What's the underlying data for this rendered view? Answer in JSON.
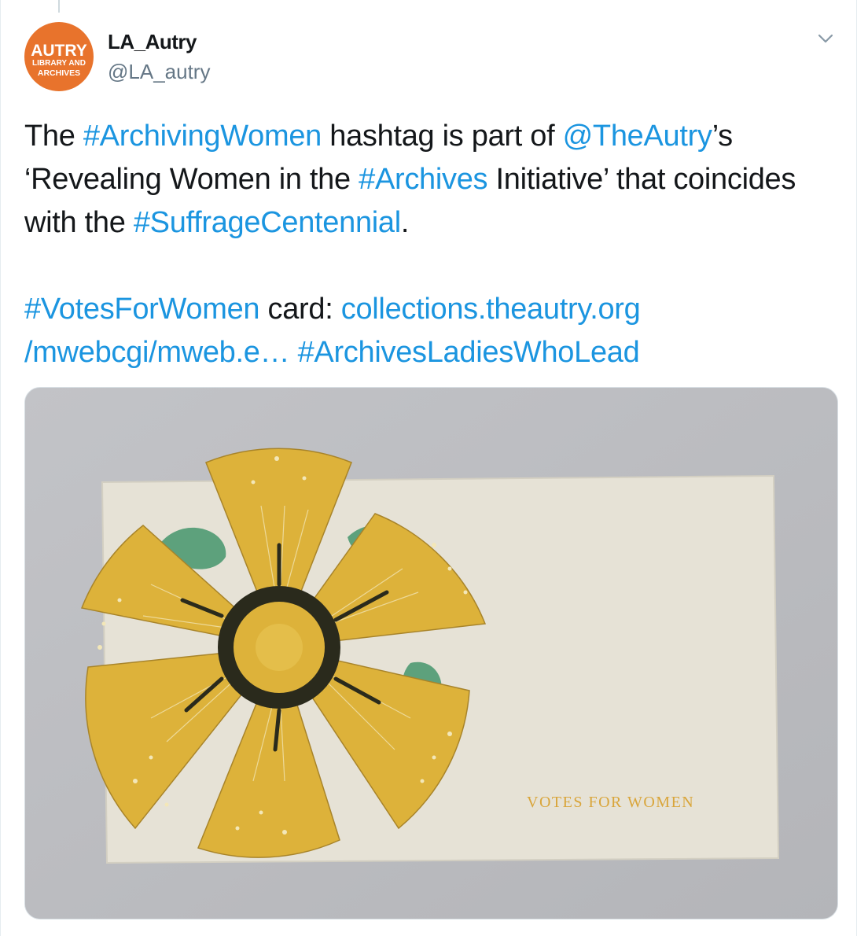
{
  "author": {
    "display_name": "LA_Autry",
    "handle": "@LA_autry",
    "avatar": {
      "line1": "AUTRY",
      "line2": "LIBRARY AND",
      "line3": "ARCHIVES",
      "color": "#e8732c"
    }
  },
  "menu_icon": "chevron-down-icon",
  "tweet": {
    "para1": {
      "t1": "The ",
      "l1": "#ArchivingWomen",
      "t2": " hashtag is part of ",
      "l2": "@TheAutry",
      "t3": "’s ‘Revealing Women in the ",
      "l3": "#Archives",
      "t4": " Initiative’ that coincides with the ",
      "l4": "#SuffrageCentennial",
      "t5": "."
    },
    "para2": {
      "l1": "#VotesForWomen",
      "t1": " card: ",
      "l2": "collections.theautry.org",
      "l3": "/mwebcgi/mweb.e…",
      "l4": "#ArchivesLadiesWhoLead"
    }
  },
  "media": {
    "card_text": "VOTES FOR WOMEN",
    "colors": {
      "background": "#bcbdc1",
      "card": "#e6e2d6",
      "petal": "#ddb23a",
      "leaf": "#4e9a72",
      "center": "#2a2a1c",
      "link": "#1b95e0"
    }
  }
}
